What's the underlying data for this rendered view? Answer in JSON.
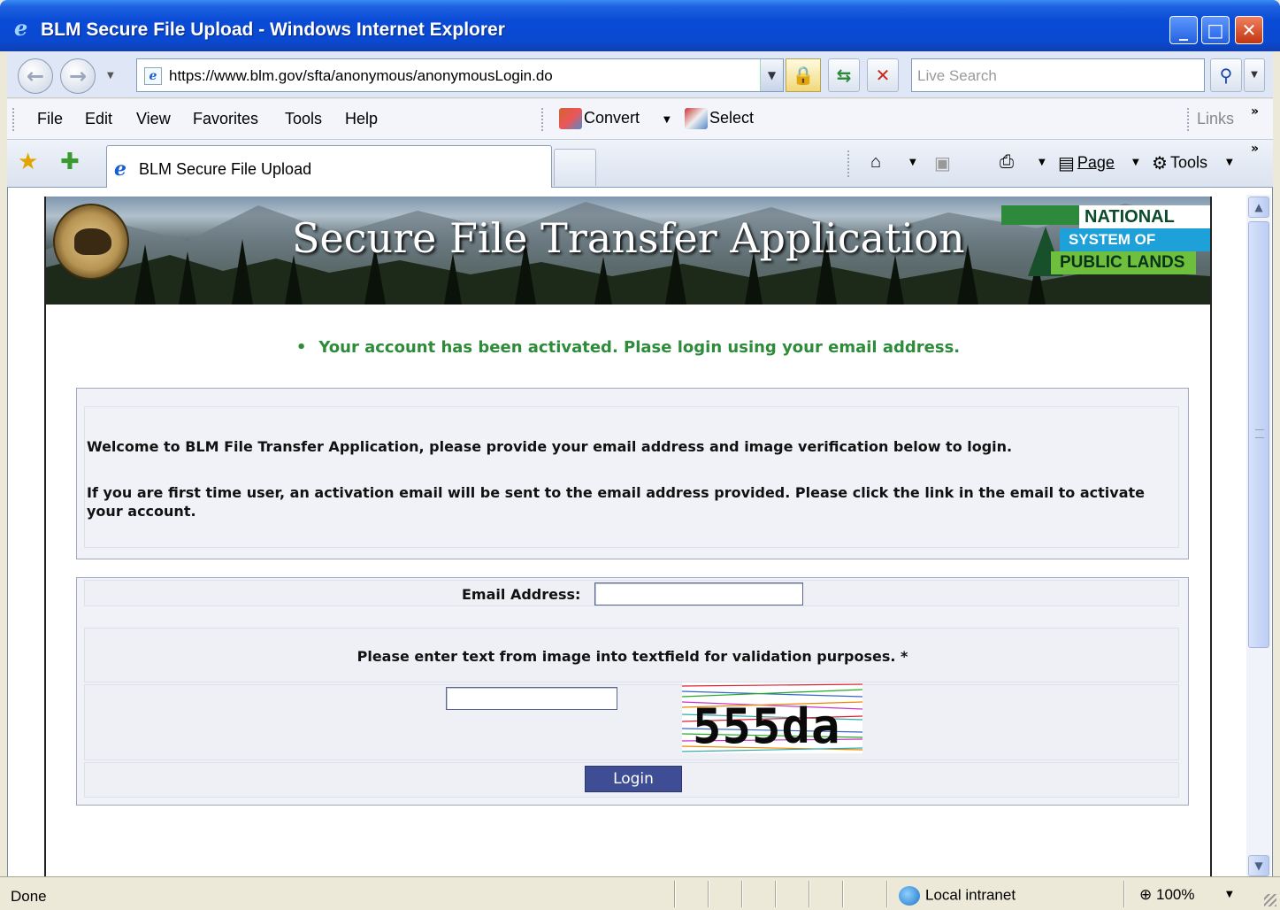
{
  "window": {
    "title": "BLM Secure File Upload - Windows Internet Explorer",
    "minimize": "_",
    "maximize": "□",
    "close": "✕"
  },
  "address_bar": {
    "url": "https://www.blm.gov/sfta/anonymous/anonymousLogin.do",
    "search_placeholder": "Live Search"
  },
  "menu": {
    "items": [
      "File",
      "Edit",
      "View",
      "Favorites",
      "Tools",
      "Help"
    ],
    "convert": "Convert",
    "select": "Select",
    "links": "Links"
  },
  "tabs": {
    "active_tab": "BLM Secure File Upload"
  },
  "command_bar": {
    "page": "Page",
    "tools": "Tools"
  },
  "page": {
    "banner_title": "Secure File Transfer Application",
    "logo_lines": [
      "NATIONAL",
      "SYSTEM OF",
      "PUBLIC LANDS"
    ],
    "success_message": "Your account has been activated. Plase login using your email address.",
    "intro_line1": "Welcome to BLM File Transfer Application, please provide your email address and image verification below to login.",
    "intro_line2": "If you are first time user, an activation email will be sent to the email address provided. Please click the link in the email to activate your account.",
    "email_label": "Email Address:",
    "email_value": "",
    "captcha_prompt": "Please enter text from image into textfield for validation purposes. *",
    "captcha_value": "",
    "captcha_text": "555da",
    "login_button": "Login"
  },
  "status_bar": {
    "status": "Done",
    "zone": "Local intranet",
    "zoom": "100%"
  },
  "colors": {
    "title_bar": "#0a4bd6",
    "success_text": "#2e8b3a",
    "login_button": "#3f4d94",
    "panel_bg": "#f0f2f8"
  },
  "icons": [
    "ie-logo-icon",
    "back-icon",
    "forward-icon",
    "lock-icon",
    "refresh-icon",
    "stop-icon",
    "search-icon",
    "star-icon",
    "add-favorite-icon",
    "home-icon",
    "feeds-icon",
    "print-icon",
    "page-icon",
    "tools-gear-icon",
    "globe-zone-icon",
    "zoom-icon"
  ]
}
